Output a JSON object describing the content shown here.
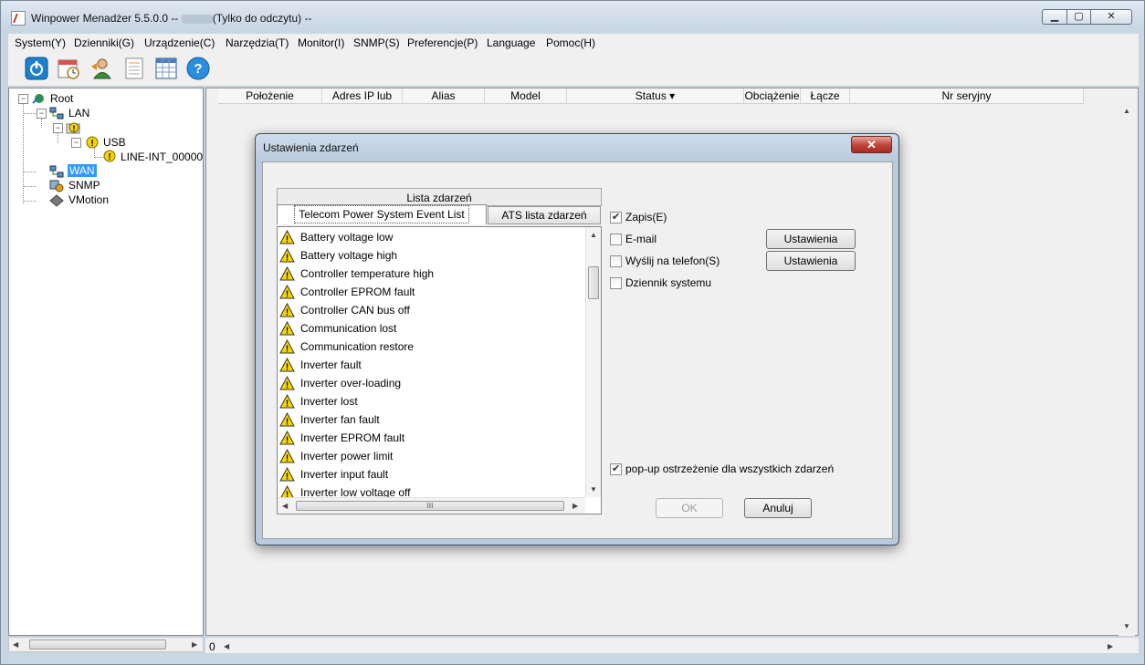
{
  "window": {
    "title_prefix": "Winpower Menadżer 5.5.0.0 -- ",
    "title_suffix": "(Tylko do odczytu) --",
    "min": "▁",
    "max": "▢",
    "close": "✕"
  },
  "menu": [
    "System(Y)",
    "Dzienniki(G)",
    "Urządzenie(C)",
    "Narzędzia(T)",
    "Monitor(I)",
    "SNMP(S)",
    "Preferencje(P)",
    "Language",
    "Pomoc(H)"
  ],
  "toolbar": {
    "icons": [
      "power-icon",
      "schedule-icon",
      "user-icon",
      "log-icon",
      "table-icon",
      "help-icon"
    ],
    "help_glyph": "?"
  },
  "tree": {
    "root": "Root",
    "lan": "LAN",
    "usb": "USB",
    "device": "LINE-INT_00000",
    "wan": "WAN",
    "snmp": "SNMP",
    "vmotion": "VMotion"
  },
  "table": {
    "columns": [
      "Położenie",
      "Adres IP lub",
      "Alias",
      "Model",
      "Status ▾",
      "Obciążenie",
      "Łącze",
      "Nr seryjny"
    ]
  },
  "status_bar": {
    "count": "0"
  },
  "dialog": {
    "title": "Ustawienia zdarzeń",
    "close": "✕",
    "list_header": "Lista zdarzeń",
    "tab_telecom": "Telecom Power System Event List",
    "tab_ats": "ATS lista zdarzeń",
    "events": [
      "Battery voltage low",
      "Battery voltage high",
      "Controller temperature high",
      "Controller EPROM fault",
      "Controller CAN bus off",
      "Communication lost",
      "Communication restore",
      "Inverter fault",
      "Inverter over-loading",
      "Inverter lost",
      "Inverter fan fault",
      "Inverter EPROM fault",
      "Inverter power limit",
      "Inverter input fault",
      "Inverter low voltage off"
    ],
    "options": {
      "zapis": {
        "label": "Zapis(E)",
        "checked": true
      },
      "email": {
        "label": "E-mail",
        "checked": false
      },
      "phone": {
        "label": "Wyślij na telefon(S)",
        "checked": false
      },
      "syslog": {
        "label": "Dziennik systemu",
        "checked": false
      },
      "popup": {
        "label": "pop-up ostrzeżenie dla wszystkich zdarzeń",
        "checked": true
      }
    },
    "settings_button": "Ustawienia",
    "ok": "OK",
    "cancel": "Anuluj",
    "hscroll_grip": "III"
  }
}
